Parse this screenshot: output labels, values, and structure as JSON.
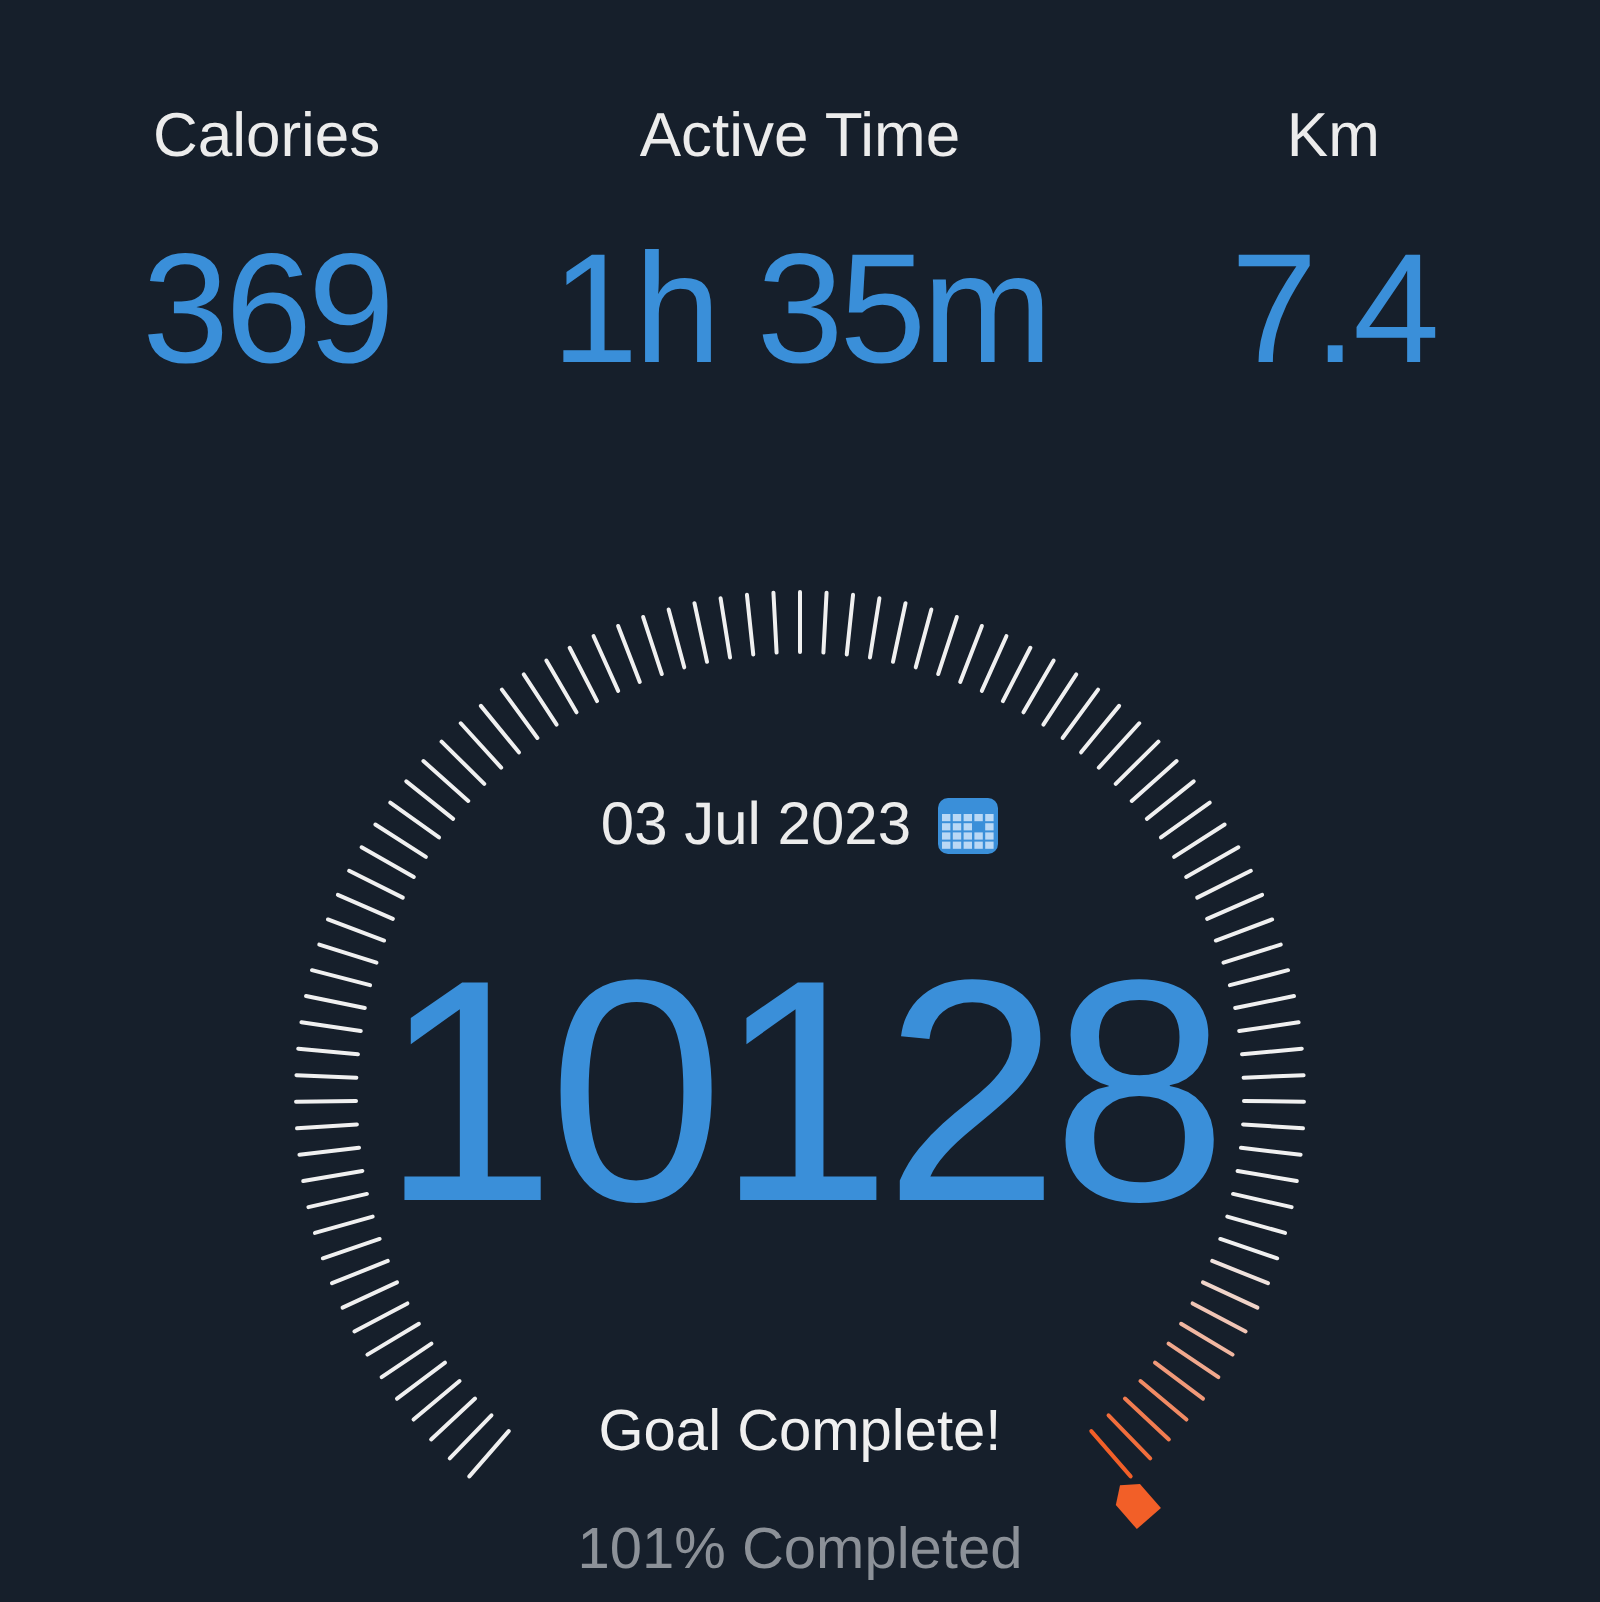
{
  "stats": [
    {
      "label": "Calories",
      "value": "369"
    },
    {
      "label": "Active Time",
      "value": "1h 35m"
    },
    {
      "label": "Km",
      "value": "7.4"
    }
  ],
  "gauge": {
    "date": "03 Jul 2023",
    "steps": "10128",
    "status": "Goal Complete!",
    "completion": "101% Completed"
  }
}
